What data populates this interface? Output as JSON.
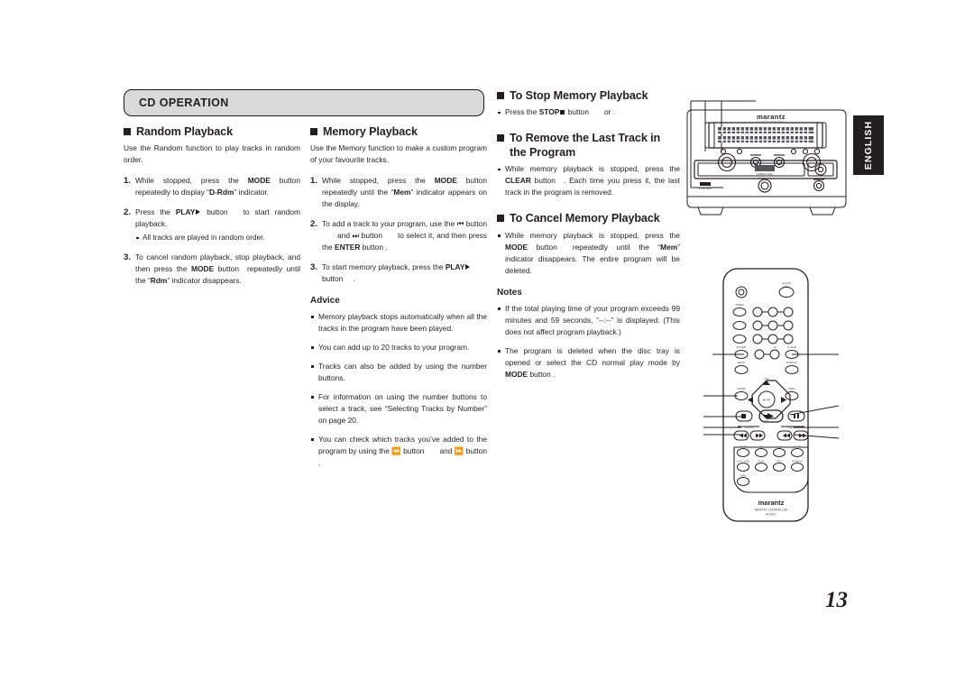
{
  "page": {
    "number": "13",
    "language_tab": "ENGLISH",
    "section_title": "CD OPERATION"
  },
  "columns": {
    "col1": {
      "heading": "Random Playback",
      "intro": "Use the Random function to play tracks in random order.",
      "steps": [
        {
          "num": "1.",
          "text_pre": "While stopped, press the ",
          "bold1": "MODE",
          "text_mid": " button ",
          "text_post": "repeatedly to display “",
          "bold2": "D-Rdm",
          "text_end": "” indicator."
        },
        {
          "num": "2.",
          "text_pre": "Press the ",
          "bold1": "PLAY",
          "text_mid": " button",
          "text_post": "to start random playback.",
          "sub": "All tracks are played in random order."
        },
        {
          "num": "3.",
          "text_pre": "To cancel random playback, stop playback, and then press the ",
          "bold1": "MODE",
          "text_mid": " button",
          "text_post": "repeatedly until the “",
          "bold2": "Rdm",
          "text_end": "” indicator disappears."
        }
      ]
    },
    "col2": {
      "heading": "Memory Playback",
      "intro": "Use the Memory function to make a custom program of your favourite tracks.",
      "steps": [
        {
          "num": "1.",
          "text_pre": "While stopped, press the ",
          "bold1": "MODE",
          "text_mid": " button ",
          "text_post": "repeatedly until the “",
          "bold2": "Mem",
          "text_end": "” indicator appears on the display."
        },
        {
          "num": "2.",
          "text_pre": "To add a track to your program, use the ",
          "glyph1": "prev",
          "text_mid": " button",
          "text_mid2": "and ",
          "glyph2": "next",
          "text_mid3": " button",
          "text_post": "to select it, and then press the ",
          "bold2": "ENTER",
          "text_end": " button ."
        },
        {
          "num": "3.",
          "text_pre": "To start memory playback, press the ",
          "bold1": "PLAY",
          "text_mid": " button ",
          "text_end": "."
        }
      ],
      "advice_heading": "Advice",
      "advice": [
        "Memory playback stops automatically when all the tracks in the program have been played.",
        "You can add up to 20 tracks to your program.",
        "Tracks can also be added by using the number buttons.",
        "For information on using the number buttons to select a track, see “Selecting Tracks by Number” on page 20."
      ],
      "advice_last": {
        "pre": "You can check which tracks you’ve added to the program by using the ",
        "glyph1": "rew",
        "mid": " button",
        "mid2": "and ",
        "glyph2": "ff",
        "post": " button ."
      }
    },
    "col3": {
      "stop_heading": "To Stop Memory Playback",
      "stop_bullet": {
        "pre": "Press the ",
        "bold": "STOP",
        "post": " button",
        "tail": "or ."
      },
      "remove_heading_line1": "To Remove the Last Track in",
      "remove_heading_line2": "the Program",
      "remove_bullet": {
        "pre": "While memory playback is stopped, press the ",
        "bold": "CLEAR",
        "post": " button",
        "tail": ". Each time you press it, the last track in the program is removed."
      },
      "cancel_heading": "To Cancel Memory Playback",
      "cancel_bullet": {
        "pre": "While memory playback is stopped, press the ",
        "bold": "MODE",
        "post": " button",
        "tail": "repeatedly until the “",
        "bold2": "Mem",
        "tail2": "” indicator disappears. The entire program will be deleted."
      },
      "notes_heading": "Notes",
      "notes": [
        "If the total playing time of your program exceeds 99 minutes and 59 seconds, “--:--” is displayed. (This does not affect program playback.)"
      ],
      "notes_last": {
        "pre": "The program is deleted when the disc tray is opened or select the CD normal play mode by ",
        "bold": "MODE",
        "post": " button ."
      }
    }
  },
  "figures": {
    "unit": {
      "name": "cd-receiver-front-panel",
      "brand": "marantz",
      "sub_brand": "CD RECEIVER CR601"
    },
    "remote": {
      "name": "remote-control",
      "brand": "marantz",
      "caption_line1": "REMOTE CONTROLLER",
      "caption_line2": "RC6101",
      "labels": {
        "clock_call": "CLOCK CALL",
        "timer": "TIMER",
        "enter": "ENTER",
        "clear": "CLEAR",
        "menu": "MENU",
        "display": "DISPLAY",
        "mode": "MODE",
        "mem": "MEM",
        "tuning": "TUNING",
        "preset": "PRESET",
        "vol": "VOL",
        "mute": "MUTE"
      },
      "keys": [
        "1",
        "2",
        "3",
        "4",
        "5",
        "6",
        "7",
        "8",
        "9",
        "0"
      ]
    }
  },
  "colors": {
    "ink": "#231f20",
    "bar_fill": "#d9d9d9",
    "tab_bg": "#231f20",
    "tab_text": "#ffffff"
  }
}
